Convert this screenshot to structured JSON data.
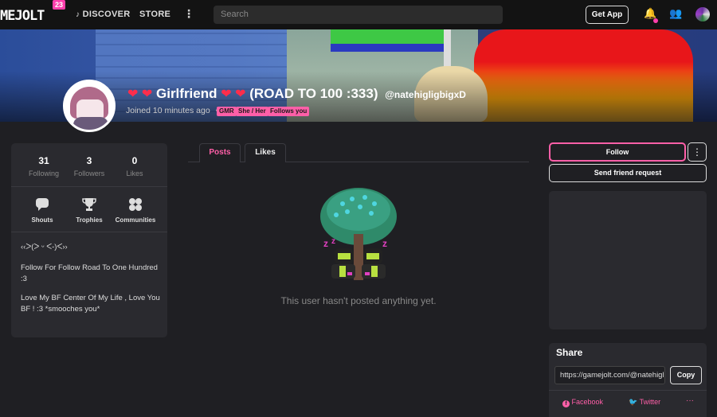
{
  "topbar": {
    "logo": "MEJOLT",
    "logo_badge": "23",
    "nav": [
      {
        "icon": "music-note-icon",
        "label": "DISCOVER"
      },
      {
        "label": "STORE"
      }
    ],
    "more_glyph": "⋮",
    "search_placeholder": "Search",
    "get_app": "Get App",
    "bell_glyph": "🔔",
    "friends_glyph": "👥"
  },
  "profile": {
    "hearts_left": "❤ ❤",
    "hearts_right": "❤ ❤",
    "name_main": "Girlfriend",
    "name_suffix": "(ROAD TO 100 :333)",
    "handle": "@natehigligbigxD",
    "joined": "Joined 10 minutes ago",
    "dot": "•",
    "tags": [
      "GMR",
      "She / Her",
      "Follows you"
    ]
  },
  "stats": [
    {
      "value": "31",
      "label": "Following"
    },
    {
      "value": "3",
      "label": "Followers"
    },
    {
      "value": "0",
      "label": "Likes"
    }
  ],
  "quick_links": [
    {
      "label": "Shouts",
      "icon": "speech-bubble-icon"
    },
    {
      "label": "Trophies",
      "icon": "trophy-icon"
    },
    {
      "label": "Communities",
      "icon": "communities-icon"
    }
  ],
  "bio": {
    "line1": "‹‹ᐳ(ᐳ ᵕ ᐸ-)ᐸ››",
    "line2": "Follow For Follow Road To One Hundred :3",
    "line3": "Love My BF Center Of My Life , Love You BF ! :3 *smooches you*"
  },
  "tabs": [
    {
      "label": "Posts",
      "active": true
    },
    {
      "label": "Likes",
      "active": false
    }
  ],
  "empty_message": "This user hasn't posted anything yet.",
  "sidebar": {
    "follow": "Follow",
    "more": "⋮",
    "friend_request": "Send friend request",
    "share_title": "Share",
    "share_url": "https://gamejolt.com/@natehigligbigxD",
    "copy": "Copy",
    "facebook": "Facebook",
    "twitter": "Twitter",
    "social_more": "···"
  },
  "colors": {
    "accent": "#ff5fa8",
    "background": "#1f1f23",
    "card": "#2a2a2f",
    "heart": "#ff2d4b"
  }
}
